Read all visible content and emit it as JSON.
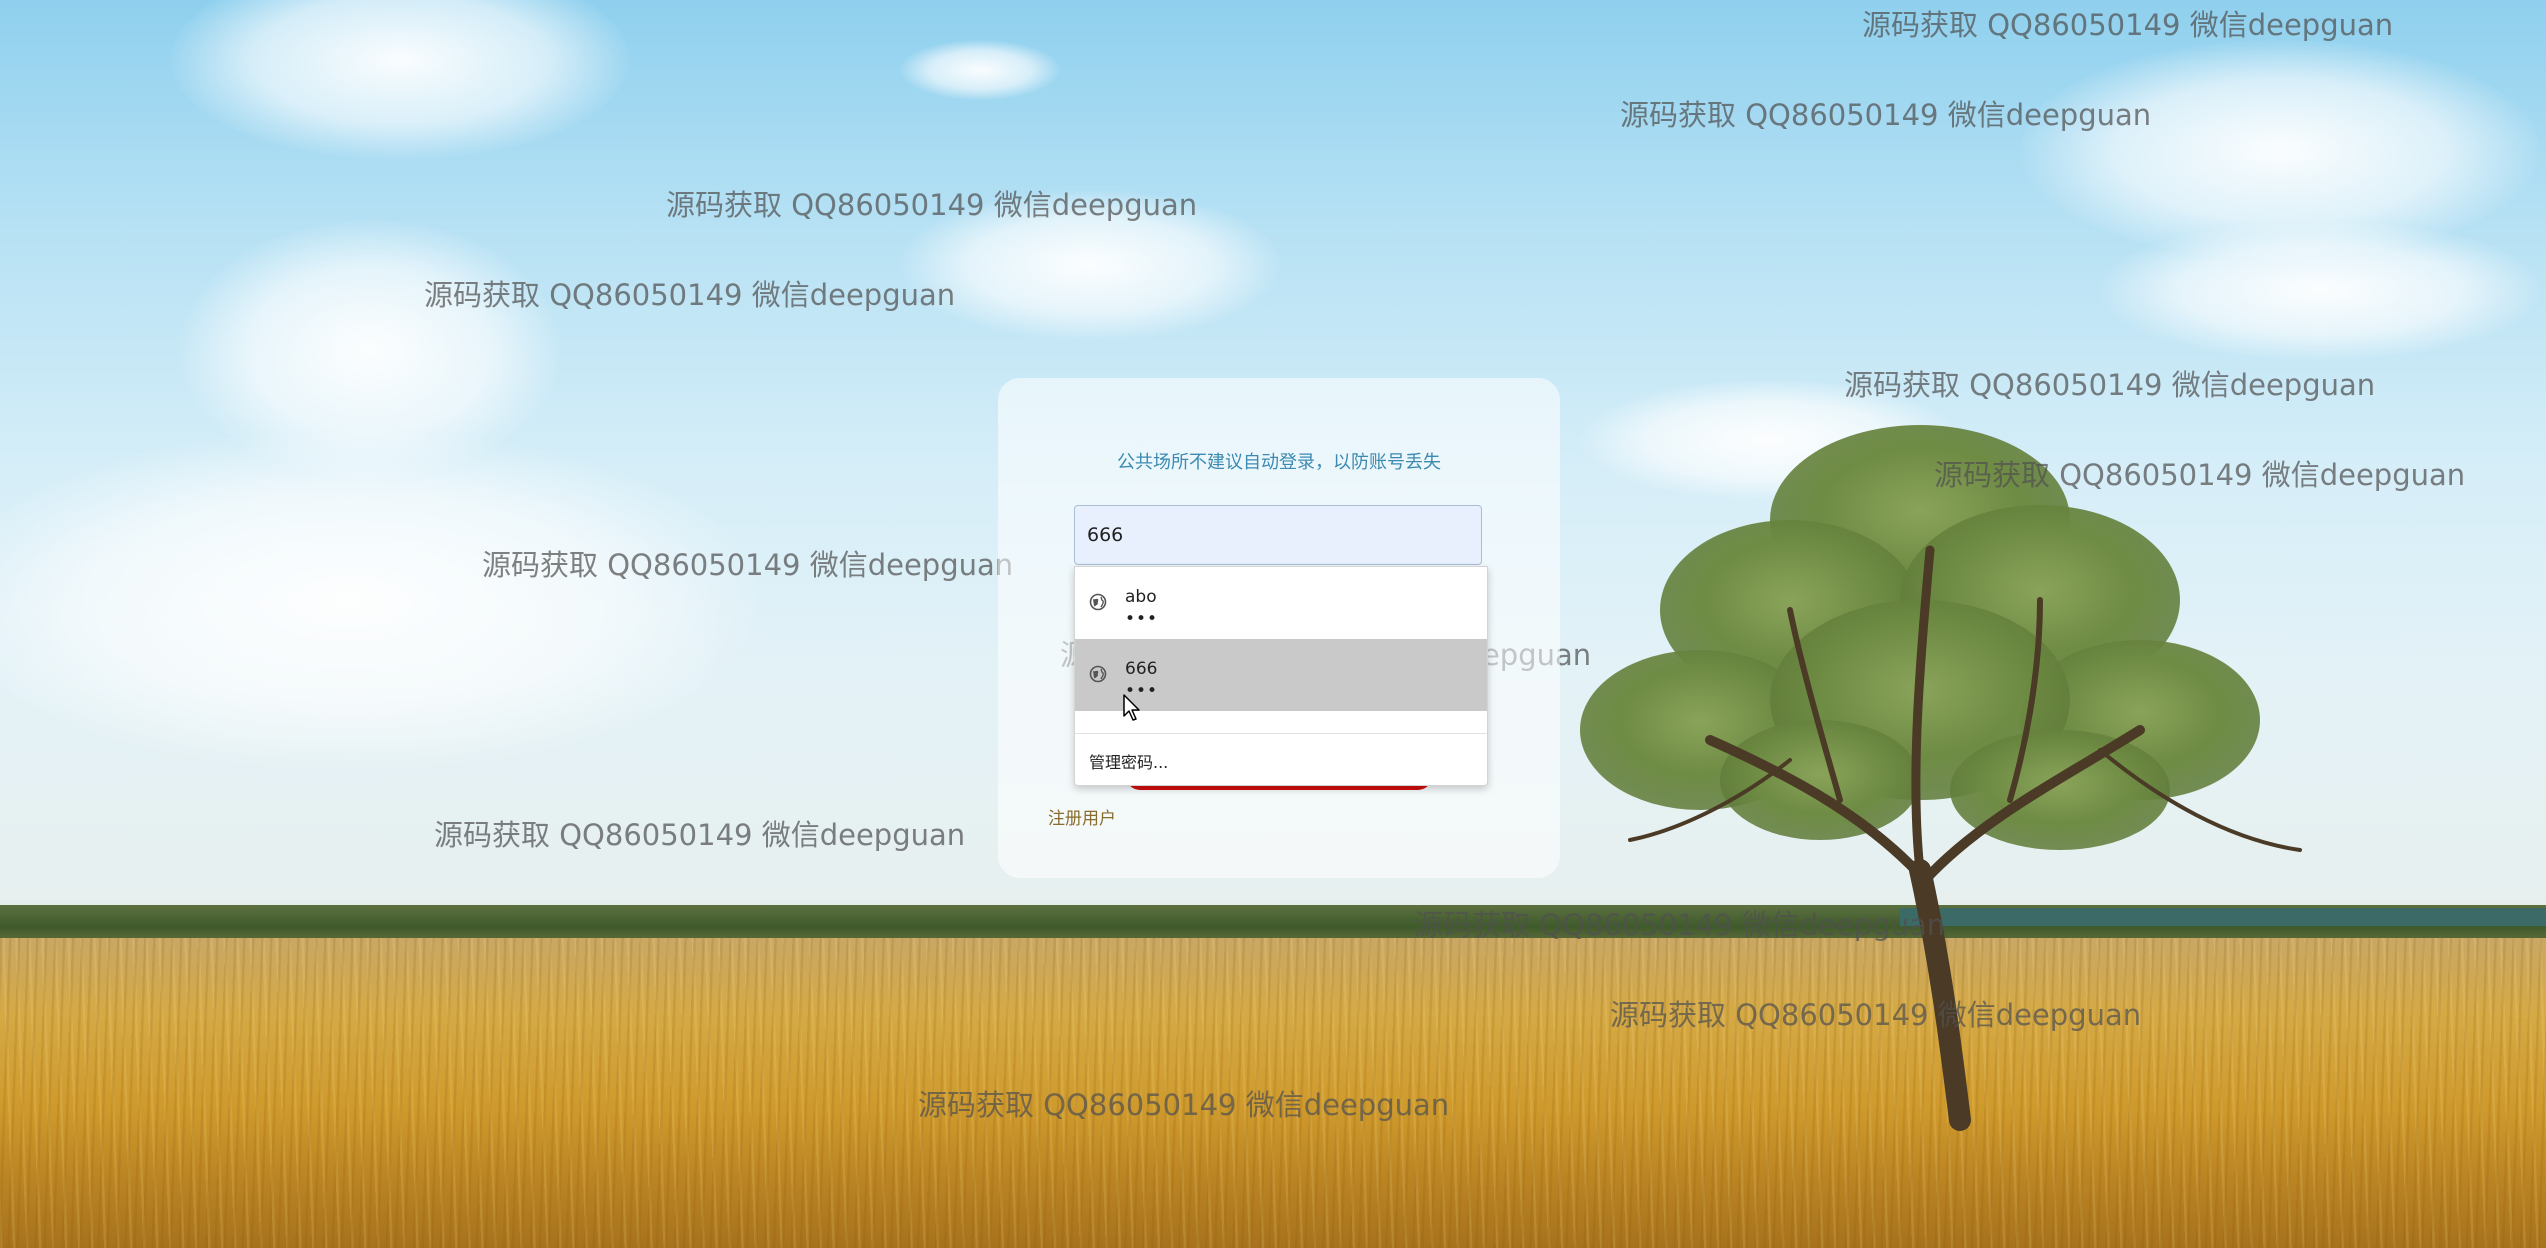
{
  "login": {
    "notice": "公共场所不建议自动登录，以防账号丢失",
    "username_value": "666",
    "register_label": "注册用户"
  },
  "autocomplete": {
    "suggestions": [
      {
        "username": "abo",
        "password_mask": "•••"
      },
      {
        "username": "666",
        "password_mask": "•••"
      }
    ],
    "manage_label": "管理密码..."
  },
  "watermark": {
    "text": "源码获取 QQ86050149 微信deepguan"
  },
  "icons": {
    "suggestion_icon": "globe-icon",
    "cursor": "mouse-pointer-icon"
  },
  "colors": {
    "notice_text": "#3b8ab0",
    "input_autofill_bg": "#e8f0fe",
    "login_button": "#d40d0d",
    "register_link": "#8a6c2e",
    "suggestion_hover": "#c9c9c9"
  }
}
